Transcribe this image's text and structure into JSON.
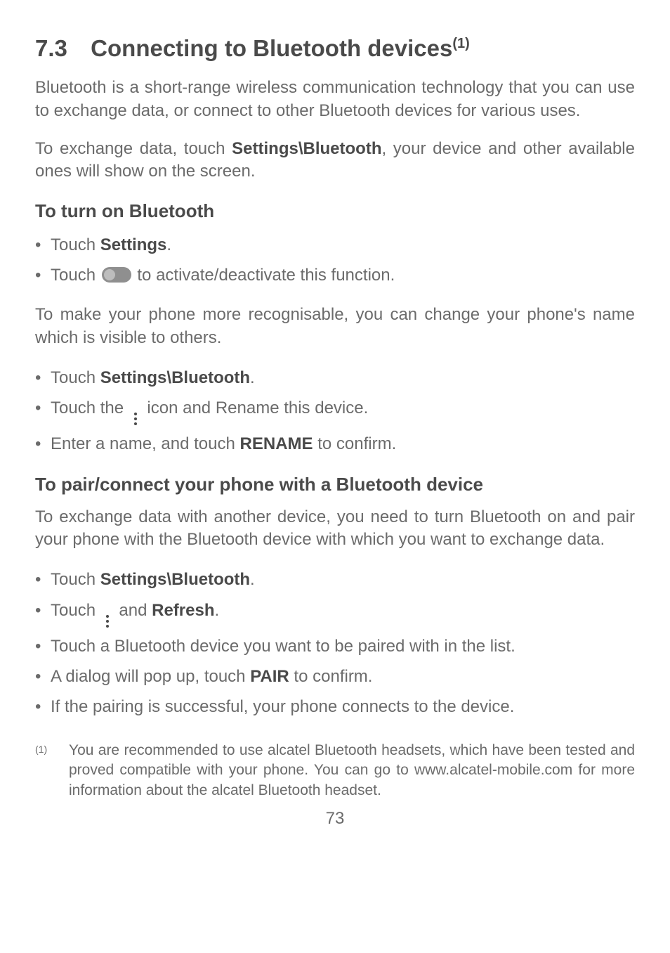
{
  "title": {
    "number": "7.3",
    "text": "Connecting to Bluetooth devices",
    "sup": "(1)"
  },
  "intro1": "Bluetooth is a short-range wireless communication technology that you can use to exchange data, or connect to other Bluetooth devices for various uses.",
  "intro2_a": "To exchange data, touch ",
  "intro2_b": "Settings\\Bluetooth",
  "intro2_c": ", your device and other available ones will show on the screen.",
  "sub1": "To turn on Bluetooth",
  "list1": {
    "i1a": "Touch ",
    "i1b": "Settings",
    "i1c": ".",
    "i2a": "Touch ",
    "i2b": " to activate/deactivate this function."
  },
  "para_rec": "To make your phone more recognisable, you can change your phone's name which is visible to others.",
  "list2": {
    "i1a": "Touch ",
    "i1b": "Settings\\Bluetooth",
    "i1c": ".",
    "i2a": "Touch the ",
    "i2b": " icon and Rename this device.",
    "i3a": "Enter a name, and touch ",
    "i3b": "RENAME",
    "i3c": " to confirm."
  },
  "sub2": "To pair/connect your phone with a Bluetooth device",
  "para_pair": "To exchange data with another device, you need to turn Bluetooth on and pair your phone with the Bluetooth device with which you want to exchange data.",
  "list3": {
    "i1a": "Touch ",
    "i1b": "Settings\\Bluetooth",
    "i1c": ".",
    "i2a": "Touch ",
    "i2b": " and ",
    "i2c": "Refresh",
    "i2d": ".",
    "i3": "Touch a Bluetooth device you want to be paired with in the list.",
    "i4a": "A dialog will pop up, touch ",
    "i4b": "PAIR",
    "i4c": " to confirm.",
    "i5": "If the pairing is successful, your phone connects to the device."
  },
  "footnote": {
    "marker": "(1)",
    "text": "You are recommended to use alcatel Bluetooth headsets, which have been tested and proved compatible with your phone. You can go to www.alcatel-mobile.com for more information about the alcatel Bluetooth headset."
  },
  "page_number": "73"
}
